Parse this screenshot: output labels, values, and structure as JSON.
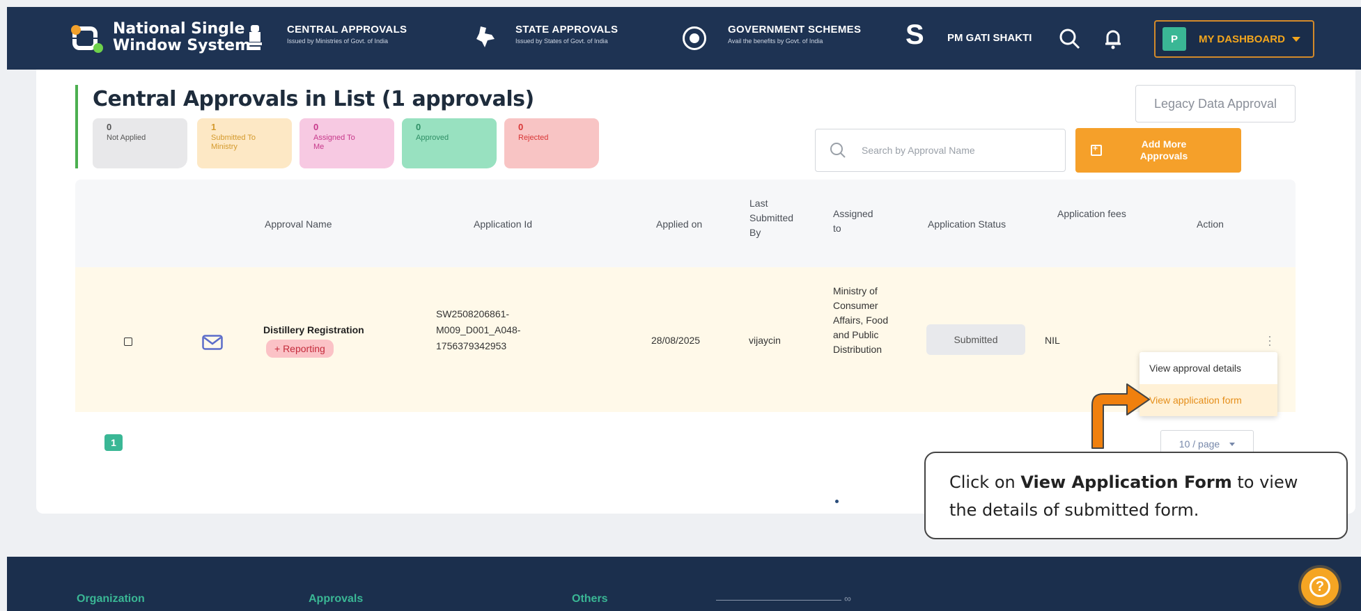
{
  "navbar": {
    "brand_line1": "National Single",
    "brand_line2": "Window System",
    "central_title": "CENTRAL APPROVALS",
    "central_sub": "Issued by Ministries of Govt. of India",
    "state_title": "STATE APPROVALS",
    "state_sub": "Issued by States of Govt. of India",
    "schemes_title": "GOVERNMENT SCHEMES",
    "schemes_sub": "Avail the benefits by Govt. of India",
    "gati": "PM GATI SHAKTI",
    "avatar": "P",
    "dashboard": "MY DASHBOARD",
    "icons": [
      "emblem-icon",
      "state-map-icon",
      "schemes-icon",
      "gati-shakti-icon",
      "search-icon",
      "bell-icon",
      "chevron-down-icon"
    ]
  },
  "page": {
    "title": "Central Approvals in List (1 approvals)",
    "legacy_button": "Legacy Data Approval"
  },
  "stats": [
    {
      "count": "0",
      "label": "Not Applied"
    },
    {
      "count": "1",
      "label": "Submitted To Ministry"
    },
    {
      "count": "0",
      "label": "Assigned To Me"
    },
    {
      "count": "0",
      "label": "Approved"
    },
    {
      "count": "0",
      "label": "Rejected"
    }
  ],
  "search": {
    "placeholder": "Search by Approval Name"
  },
  "add_button": "Add More Approvals",
  "table": {
    "headers": {
      "approval_name": "Approval Name",
      "application_id": "Application Id",
      "applied_on": "Applied on",
      "last_submitted_by": "Last Submitted By",
      "assigned_to": "Assigned to",
      "application_status": "Application Status",
      "application_fees": "Application fees",
      "action": "Action"
    },
    "rows": [
      {
        "approval_name": "Distillery Registration",
        "tag": "+ Reporting",
        "application_id": "SW2508206861-M009_D001_A048-1756379342953",
        "applied_on": "28/08/2025",
        "last_submitted_by": "vijaycin",
        "assigned_to": "Ministry of Consumer Affairs, Food and Public Distribution",
        "status": "Submitted",
        "fees": "NIL"
      }
    ]
  },
  "action_menu": {
    "items": [
      "View approval details",
      "View application form"
    ],
    "highlighted": "View application form"
  },
  "pagination": {
    "current": "1",
    "per_page": "10 / page"
  },
  "callout": {
    "prefix": "Click on ",
    "bold": "View Application Form",
    "suffix": " to view the details of submitted form."
  },
  "footer": {
    "columns": [
      "Organization",
      "Approvals",
      "Others"
    ]
  },
  "colors": {
    "navbar": "#1e3353",
    "accent_orange": "#f5a02a",
    "accent_green": "#3ab795",
    "row_highlight": "#fff9e9"
  }
}
